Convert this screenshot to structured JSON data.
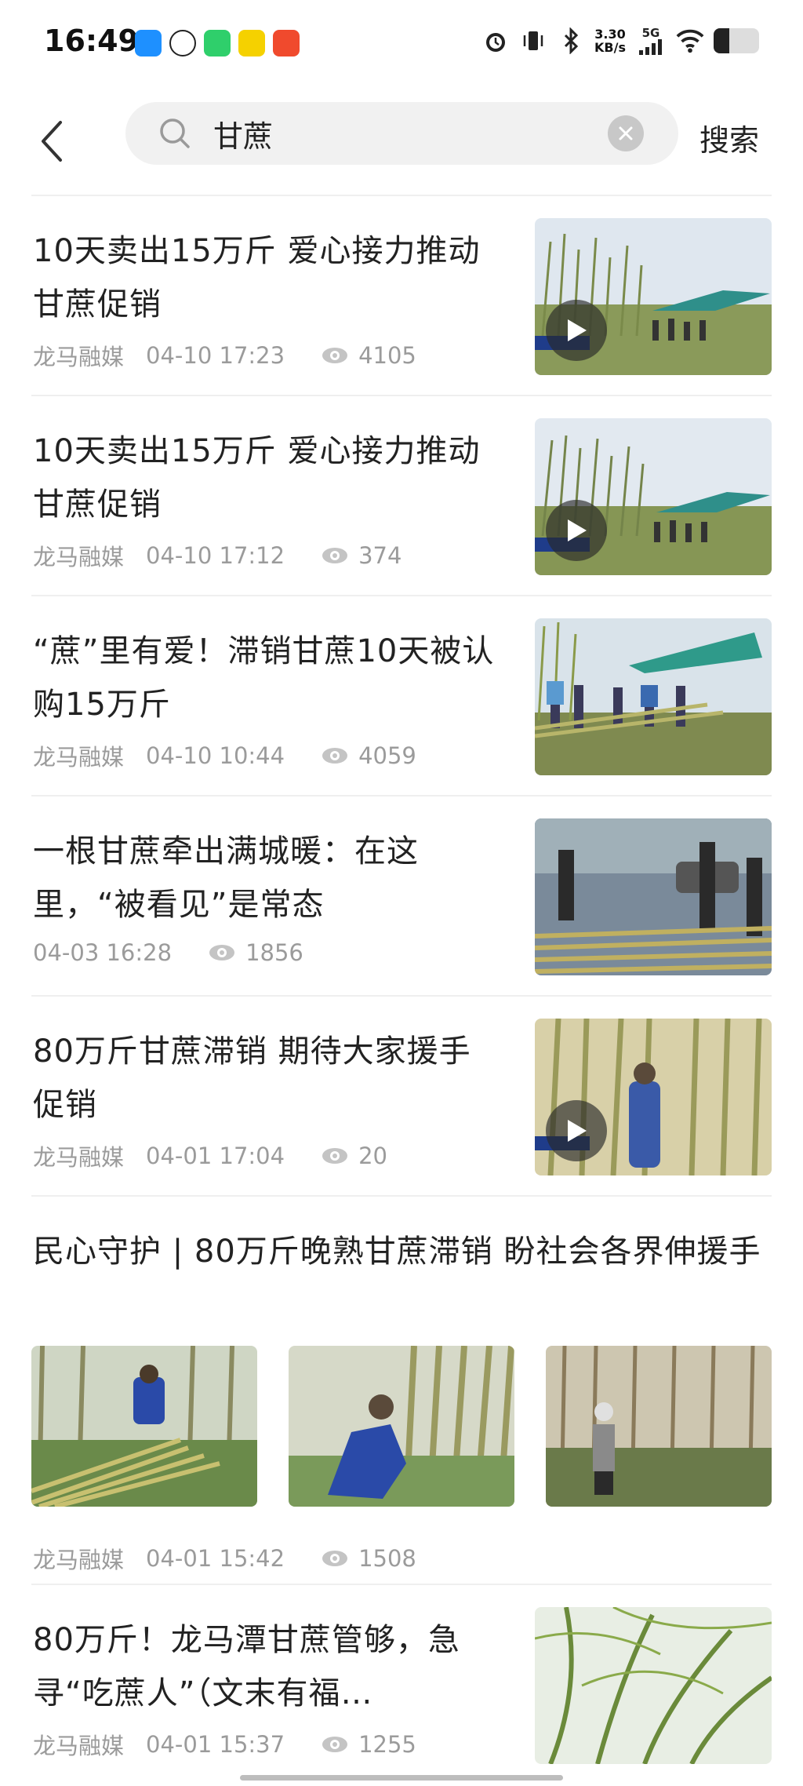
{
  "status_bar": {
    "time": "16:49",
    "net_speed_value": "3.30",
    "net_speed_unit": "KB/s",
    "signal": "5G",
    "battery_level": 0.35
  },
  "search": {
    "query": "甘蔗",
    "submit_label": "搜索"
  },
  "news": [
    {
      "title": "10天卖出15万斤 爱心接力推动甘蔗促销",
      "source": "龙马融媒",
      "time": "04-10 17:23",
      "views": "4105",
      "has_video": true
    },
    {
      "title": "10天卖出15万斤 爱心接力推动甘蔗促销",
      "source": "龙马融媒",
      "time": "04-10 17:12",
      "views": "374",
      "has_video": true
    },
    {
      "title": "“蔗”里有爱！滞销甘蔗10天被认购15万斤",
      "source": "龙马融媒",
      "time": "04-10 10:44",
      "views": "4059",
      "has_video": false
    },
    {
      "title": "一根甘蔗牵出满城暖：在这里，“被看见”是常态",
      "source": "",
      "time": "04-03 16:28",
      "views": "1856",
      "has_video": false
    },
    {
      "title": "80万斤甘蔗滞销 期待大家援手促销",
      "source": "龙马融媒",
      "time": "04-01 17:04",
      "views": "20",
      "has_video": true
    },
    {
      "title": "民心守护 | 80万斤晚熟甘蔗滞销 盼社会各界伸援手",
      "source": "龙马融媒",
      "time": "04-01 15:42",
      "views": "1508",
      "has_video": false
    },
    {
      "title": "80万斤！龙马潭甘蔗管够，急寻“吃蔗人”（文末有福…",
      "source": "龙马融媒",
      "time": "04-01 15:37",
      "views": "1255",
      "has_video": false
    }
  ],
  "icons": {
    "back": "back-arrow-icon",
    "search": "search-icon",
    "clear": "clear-icon",
    "views": "eye-icon",
    "play": "play-icon"
  },
  "colors": {
    "meta_text": "#9b9b9b",
    "search_bg": "#f1f1f1",
    "divider": "#efefef"
  }
}
